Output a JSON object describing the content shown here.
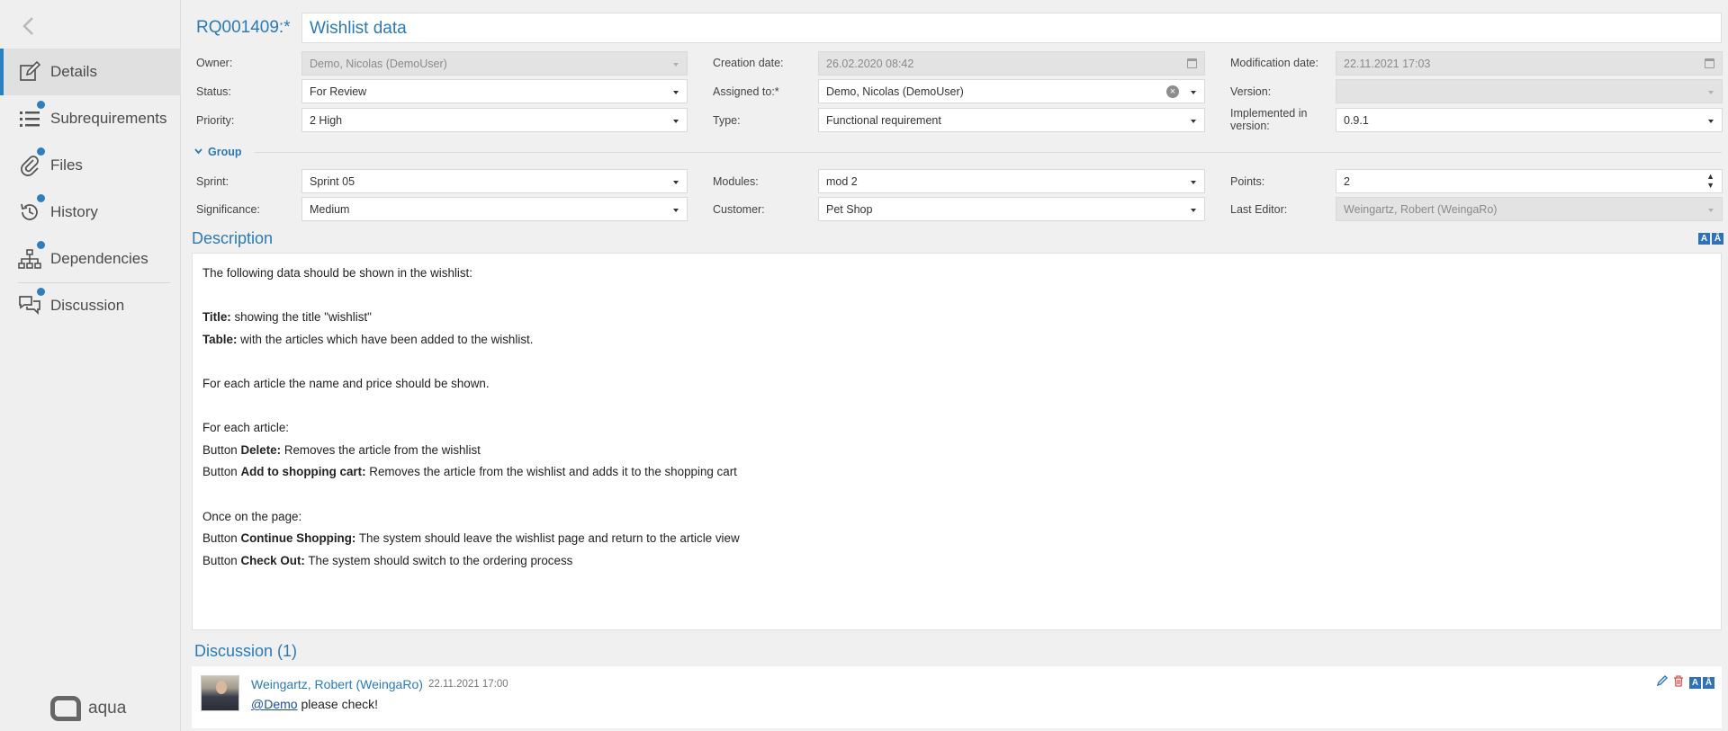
{
  "sidebar": {
    "back_icon": "chevron-left-icon",
    "items": [
      {
        "label": "Details",
        "icon": "edit-icon",
        "active": true,
        "dot": false
      },
      {
        "label": "Subrequirements",
        "icon": "list-icon",
        "dot": true
      },
      {
        "label": "Files",
        "icon": "paperclip-icon",
        "dot": true
      },
      {
        "label": "History",
        "icon": "history-icon",
        "dot": true
      },
      {
        "label": "Dependencies",
        "icon": "hierarchy-icon",
        "dot": true
      },
      {
        "label": "Discussion",
        "icon": "chat-icon",
        "dot": true
      }
    ],
    "logo_text": "aqua"
  },
  "header": {
    "req_id": "RQ001409:*",
    "title": "Wishlist data"
  },
  "fields": {
    "owner": {
      "label": "Owner:",
      "value": "Demo, Nicolas (DemoUser)"
    },
    "creation_date": {
      "label": "Creation date:",
      "value": "26.02.2020 08:42"
    },
    "modification_date": {
      "label": "Modification date:",
      "value": "22.11.2021 17:03"
    },
    "status": {
      "label": "Status:",
      "value": "For Review"
    },
    "assigned_to": {
      "label": "Assigned to:*",
      "value": "Demo, Nicolas (DemoUser)"
    },
    "version": {
      "label": "Version:",
      "value": ""
    },
    "priority": {
      "label": "Priority:",
      "value": "2 High"
    },
    "type": {
      "label": "Type:",
      "value": "Functional requirement"
    },
    "implemented_in_version": {
      "label": "Implemented in version:",
      "value": "0.9.1"
    }
  },
  "group": {
    "label": "Group",
    "sprint": {
      "label": "Sprint:",
      "value": "Sprint 05"
    },
    "modules": {
      "label": "Modules:",
      "value": "mod 2"
    },
    "points": {
      "label": "Points:",
      "value": "2"
    },
    "significance": {
      "label": "Significance:",
      "value": "Medium"
    },
    "customer": {
      "label": "Customer:",
      "value": "Pet Shop"
    },
    "last_editor": {
      "label": "Last Editor:",
      "value": "Weingartz, Robert (WeingaRo)"
    }
  },
  "description": {
    "title": "Description",
    "lines": [
      {
        "bold": "",
        "text": "The following data should be shown in the wishlist:"
      },
      {
        "bold": "",
        "text": ""
      },
      {
        "bold": "Title:",
        "text": " showing the title \"wishlist\""
      },
      {
        "bold": "Table:",
        "text": " with the articles which have been added to the wishlist."
      },
      {
        "bold": "",
        "text": ""
      },
      {
        "bold": "",
        "text": "For each article the name and price should be shown."
      },
      {
        "bold": "",
        "text": ""
      },
      {
        "bold": "",
        "text": "For each article:"
      },
      {
        "prefix": "Button ",
        "bold": "Delete:",
        "text": " Removes the article from the wishlist"
      },
      {
        "prefix": "Button ",
        "bold": "Add to shopping cart:",
        "text": " Removes the article from the wishlist and adds it to the shopping cart"
      },
      {
        "bold": "",
        "text": ""
      },
      {
        "bold": "",
        "text": "Once on the page:"
      },
      {
        "prefix": "Button ",
        "bold": "Continue Shopping:",
        "text": " The system should leave the wishlist page and return to the article view"
      },
      {
        "prefix": "Button ",
        "bold": "Check Out:",
        "text": " The system should switch to the ordering process"
      }
    ]
  },
  "discussion": {
    "title": "Discussion (1)",
    "comments": [
      {
        "author": "Weingartz, Robert (WeingaRo)",
        "date": "22.11.2021 17:00",
        "mention": "@Demo",
        "text": " please check!"
      }
    ]
  },
  "format_buttons": [
    "A",
    "Ā"
  ]
}
